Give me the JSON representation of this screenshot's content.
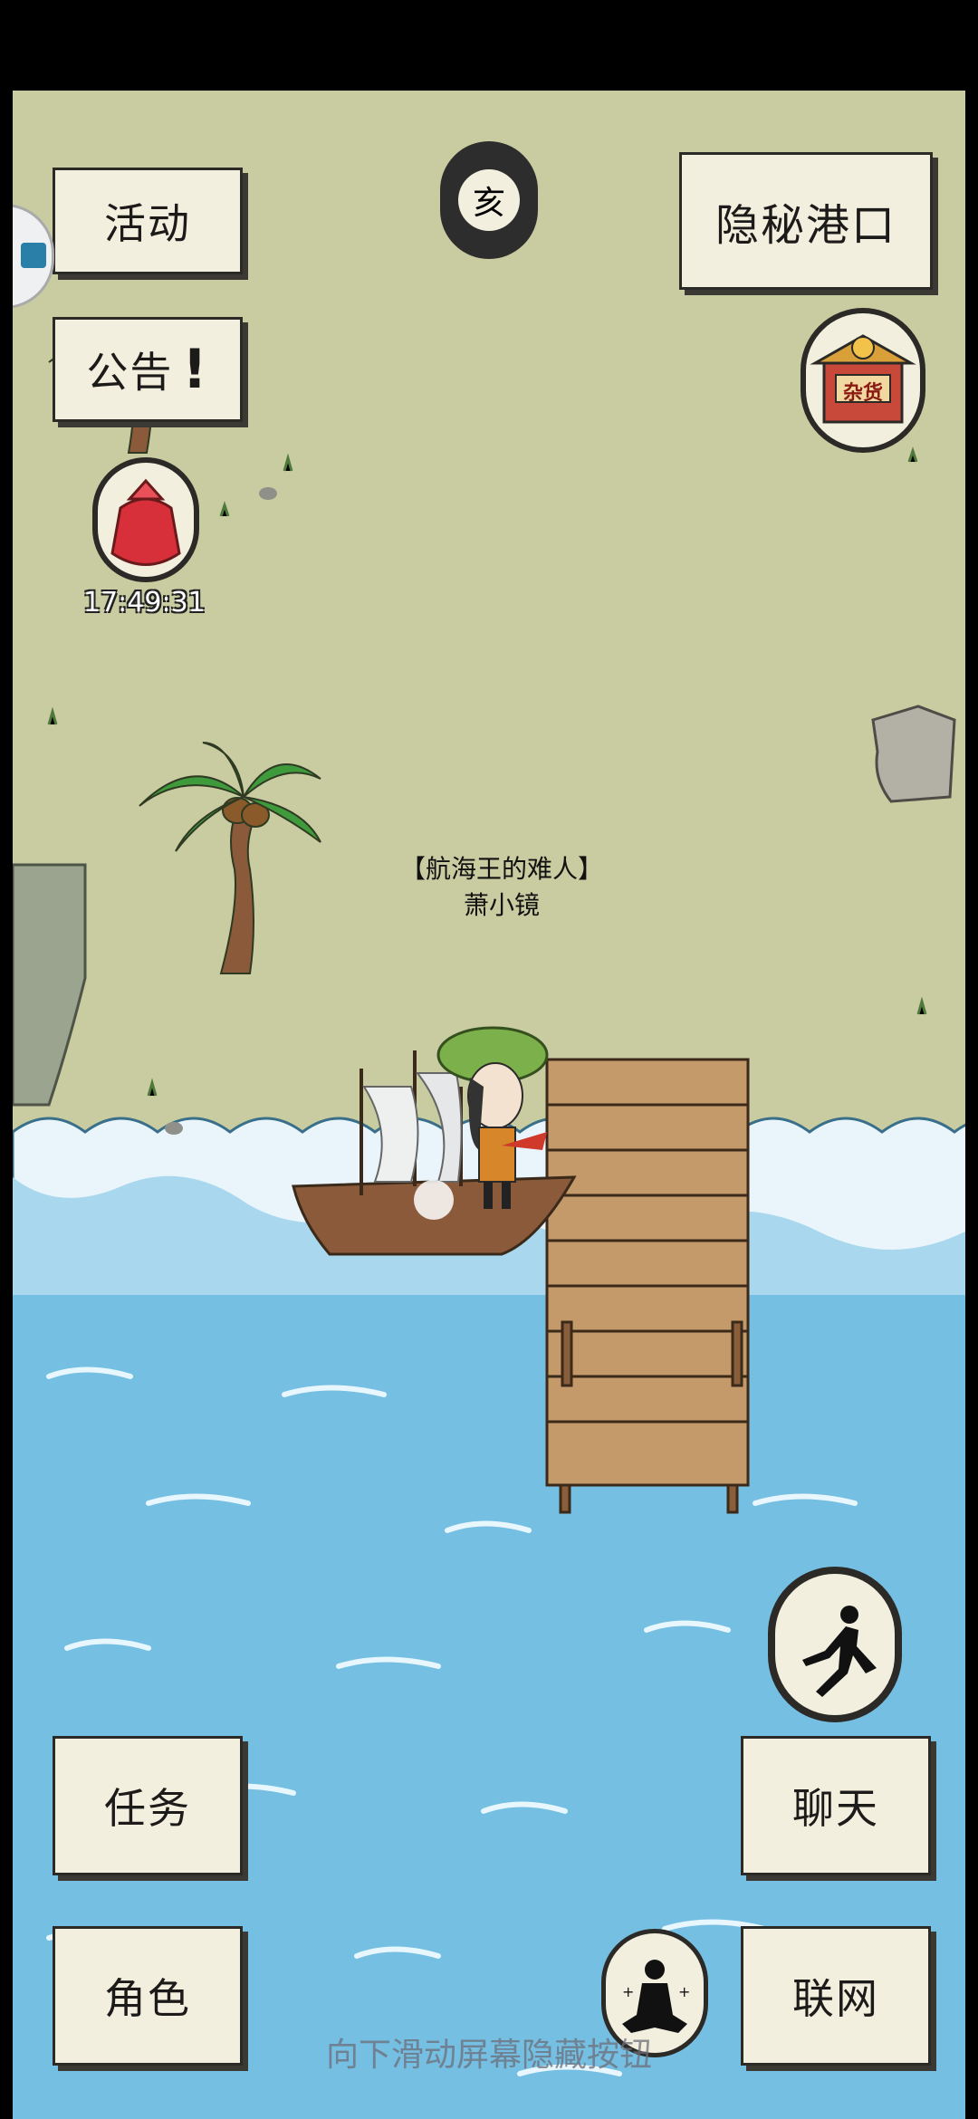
{
  "buttons": {
    "activity": "活动",
    "announcement": "公告",
    "location": "隐秘港口",
    "quest": "任务",
    "chat": "聊天",
    "character": "角色",
    "network": "联网"
  },
  "zodiac_hour": "亥",
  "shop_sign": "杂货",
  "timer": "17:49:31",
  "player": {
    "title": "【航海王的难人】",
    "name": "萧小镜"
  },
  "hint": "向下滑动屏幕隐藏按钮",
  "icons": [
    "gift-bag-icon",
    "shop-icon",
    "run-icon",
    "meditate-icon",
    "exclamation-icon"
  ],
  "colors": {
    "land": "#c9cba0",
    "sea": "#74bfe2",
    "button_bg": "#f3efdf",
    "ink": "#2b2a27"
  }
}
